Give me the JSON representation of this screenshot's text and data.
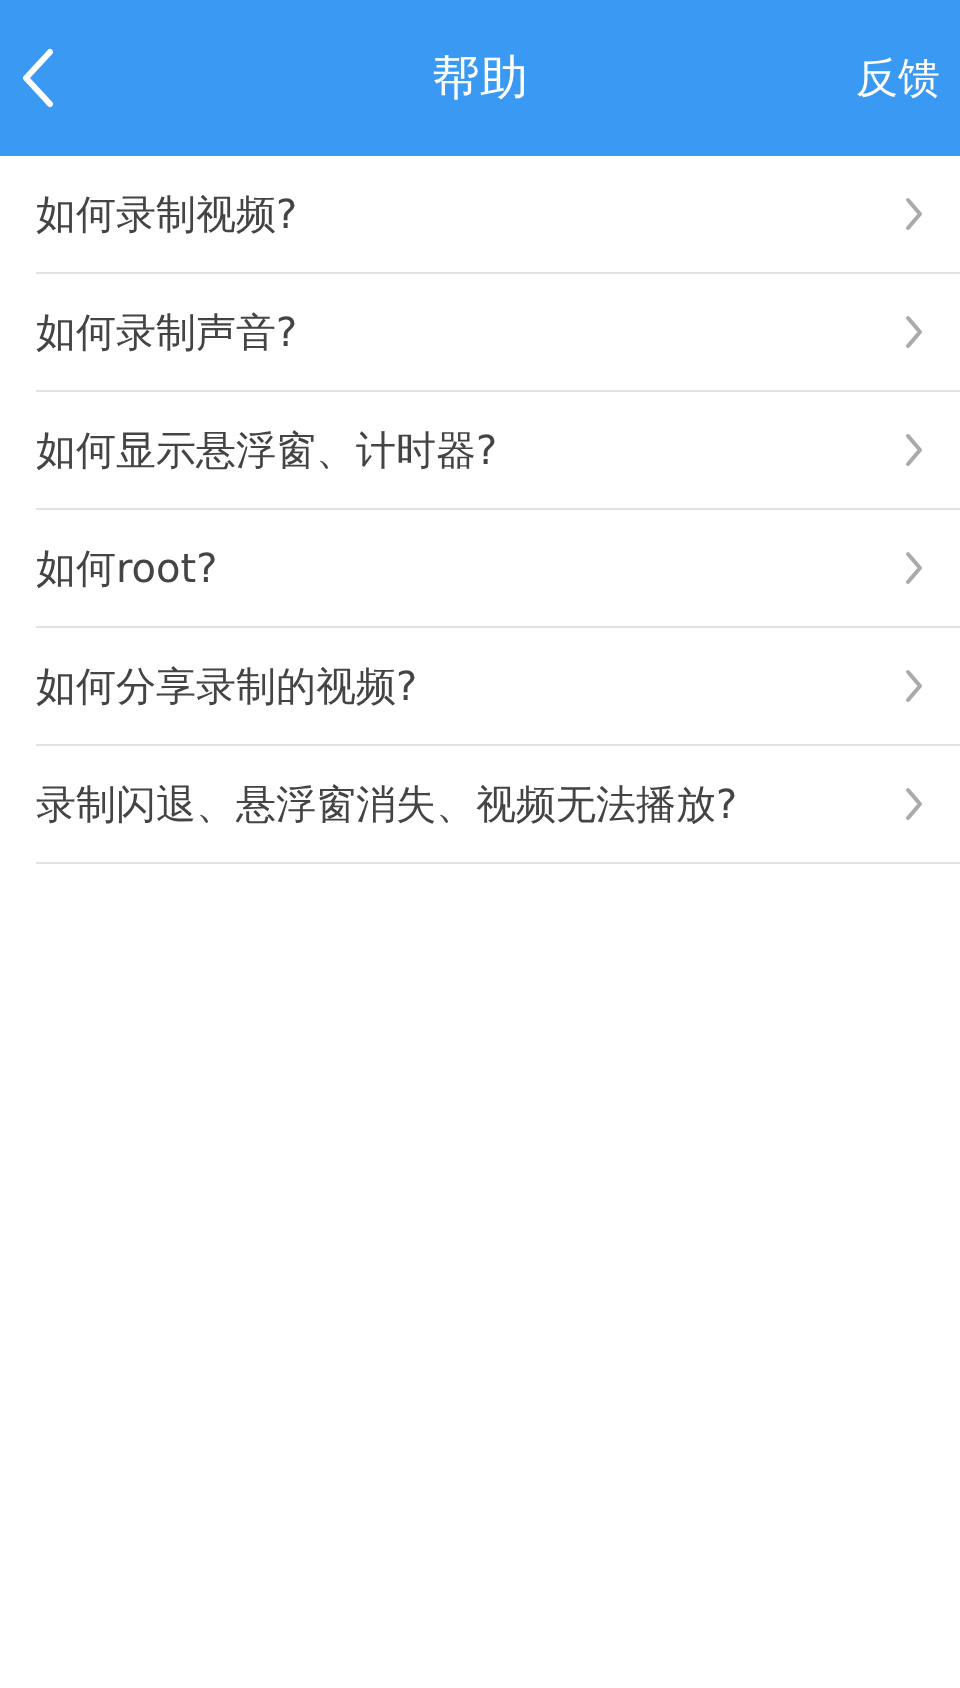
{
  "header": {
    "title": "帮助",
    "action": "反馈"
  },
  "items": [
    {
      "label": "如何录制视频?"
    },
    {
      "label": "如何录制声音?"
    },
    {
      "label": "如何显示悬浮窗、计时器?"
    },
    {
      "label": "如何root?"
    },
    {
      "label": "如何分享录制的视频?"
    },
    {
      "label": "录制闪退、悬浮窗消失、视频无法播放?"
    }
  ]
}
